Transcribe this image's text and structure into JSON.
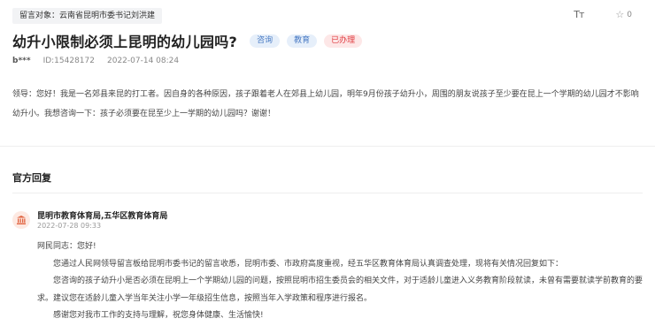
{
  "header": {
    "target_label": "留言对象：云南省昆明市委书记刘洪建",
    "font_size_label": "Tт",
    "like_count": "0"
  },
  "message": {
    "title": "幼升小限制必须上昆明的幼儿园吗?",
    "tags": [
      "咨询",
      "教育",
      "已办理"
    ],
    "user": "b***",
    "id_text": "ID:15428172",
    "datetime": "2022-07-14 08:24",
    "content": "领导：您好！我是一名郊县来昆的打工者。因自身的各种原因，孩子跟着老人在郊县上幼儿园，明年9月份孩子幼升小，周围的朋友说孩子至少要在昆上一个学期的幼儿园才不影响幼升小。我想咨询一下：孩子必须要在昆至少上一学期的幼儿园吗？谢谢！"
  },
  "reply": {
    "section_title": "官方回复",
    "org_name": "昆明市教育体育局,五华区教育体育局",
    "date": "2022-07-28 09:33",
    "paragraphs": [
      "网民同志：您好!",
      "您通过人民网领导留言板给昆明市委书记的留言收悉，昆明市委、市政府高度重视，经五华区教育体育局认真调查处理，现将有关情况回复如下：",
      "您咨询的孩子幼升小是否必须在昆明上一个学期幼儿园的问题，按照昆明市招生委员会的相关文件，对于适龄儿童进入义务教育阶段就读，未曾有需要就读学前教育的要求。建议您在适龄儿童入学当年关注小学一年级招生信息，按照当年入学政策和程序进行报名。",
      "感谢您对我市工作的支持与理解，祝您身体健康、生活愉快!"
    ]
  },
  "colors": {
    "tag_blue_bg": "#e6effa",
    "tag_blue_text": "#4a7bc4",
    "tag_red_bg": "#fde7e7",
    "tag_red_text": "#e0393e",
    "icon_accent": "#e0623e"
  }
}
